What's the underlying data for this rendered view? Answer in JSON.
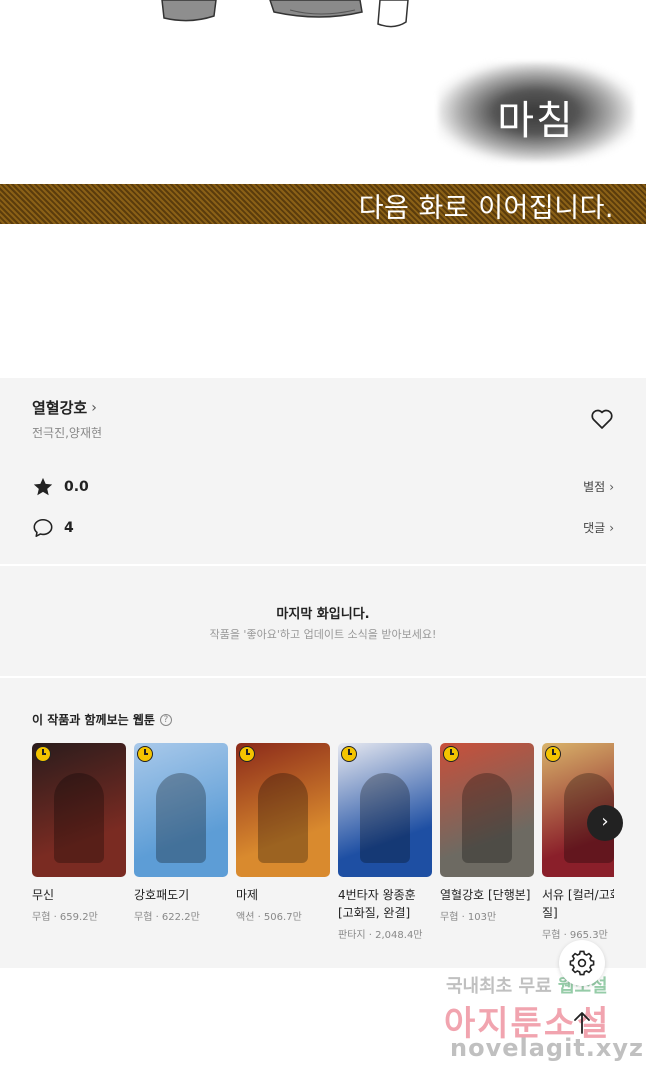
{
  "episode_end": {
    "finish_label": "마침",
    "next_notice": "다음 화로 이어집니다."
  },
  "work": {
    "title": "열혈강호",
    "authors": "전극진,양재현",
    "rating": "0.0",
    "rating_link": "별점",
    "comments": "4",
    "comments_link": "댓글"
  },
  "last_episode": {
    "title": "마지막 화입니다.",
    "subtitle": "작품을 '좋아요'하고 업데이트 소식을 받아보세요!"
  },
  "recommendations": {
    "heading": "이 작품과 함께보는 웹툰",
    "help_glyph": "?",
    "items": [
      {
        "title": "무신",
        "meta": "무협 · 659.2만",
        "colors": [
          "#7a2b22",
          "#2a1c1c"
        ]
      },
      {
        "title": "강호패도기",
        "meta": "무협 · 622.2만",
        "colors": [
          "#5d9dd6",
          "#a9c9ea"
        ]
      },
      {
        "title": "마제",
        "meta": "액션 · 506.7만",
        "colors": [
          "#d98a2e",
          "#8b2a1a"
        ]
      },
      {
        "title": "4번타자 왕종훈 [고화질, 완결]",
        "meta": "판타지 · 2,048.4만",
        "colors": [
          "#1e4fa3",
          "#e6e8f0"
        ]
      },
      {
        "title": "열혈강호 [단행본]",
        "meta": "무협 · 103만",
        "colors": [
          "#6d6a62",
          "#c94f3a"
        ]
      },
      {
        "title": "서유 [컬러/고화질]",
        "meta": "무협 · 965.3만",
        "colors": [
          "#8a1f2a",
          "#d9b36a"
        ]
      }
    ],
    "next_glyph": "›"
  },
  "watermark": {
    "line1_a": "국내최초 무료 ",
    "line1_b": "웹소설",
    "line2": "아지툰소설",
    "line3": "novelagit.xyz"
  }
}
